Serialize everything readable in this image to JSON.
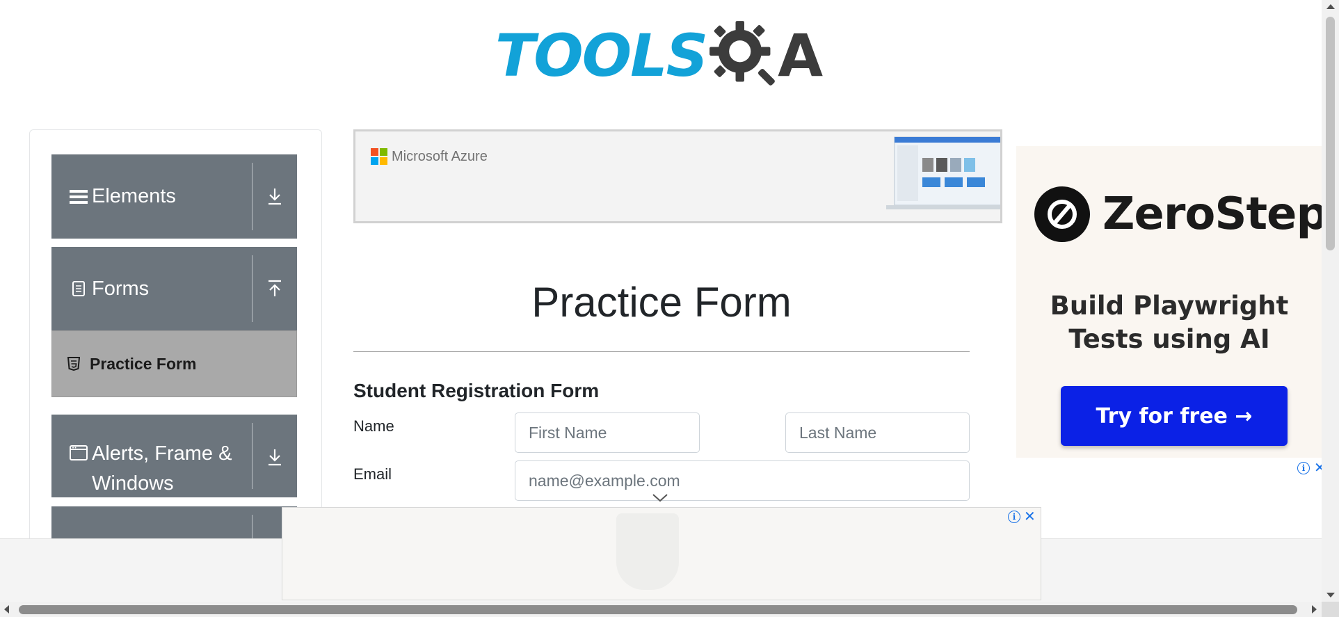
{
  "header": {
    "logo_text": "TOOLS",
    "logo_suffix": "A"
  },
  "sidebar": {
    "groups": [
      {
        "label": "Elements",
        "icon": "hamburger-icon",
        "toggle": "download-arrow-icon"
      },
      {
        "label": "Forms",
        "icon": "document-icon",
        "toggle": "upload-arrow-icon"
      },
      {
        "label_line1": "Alerts, Frame &",
        "label_line2": "Windows",
        "icon": "window-icon",
        "toggle": "download-arrow-icon"
      }
    ],
    "active_item": {
      "label": "Practice Form",
      "icon": "html5-icon"
    }
  },
  "azure_banner": {
    "text": "Microsoft Azure",
    "colors": [
      "#f25022",
      "#7fba00",
      "#00a4ef",
      "#ffb900"
    ]
  },
  "main": {
    "title": "Practice Form",
    "form_heading": "Student Registration Form",
    "name_label": "Name",
    "first_name_placeholder": "First Name",
    "last_name_placeholder": "Last Name",
    "email_label": "Email",
    "email_placeholder": "name@example.com"
  },
  "right_ad": {
    "brand": "ZeroStep",
    "tagline_line1": "Build Playwright",
    "tagline_line2": "Tests using AI",
    "cta": "Try for free →",
    "info_glyph": "i",
    "close_glyph": "✕"
  },
  "bottom_ad": {
    "info_glyph": "i",
    "close_glyph": "✕"
  },
  "colors": {
    "brand_blue": "#12a2d8",
    "sidebar_gray": "#6c757d",
    "active_item_gray": "#a9a9a9",
    "cta_blue": "#0b21e6"
  }
}
